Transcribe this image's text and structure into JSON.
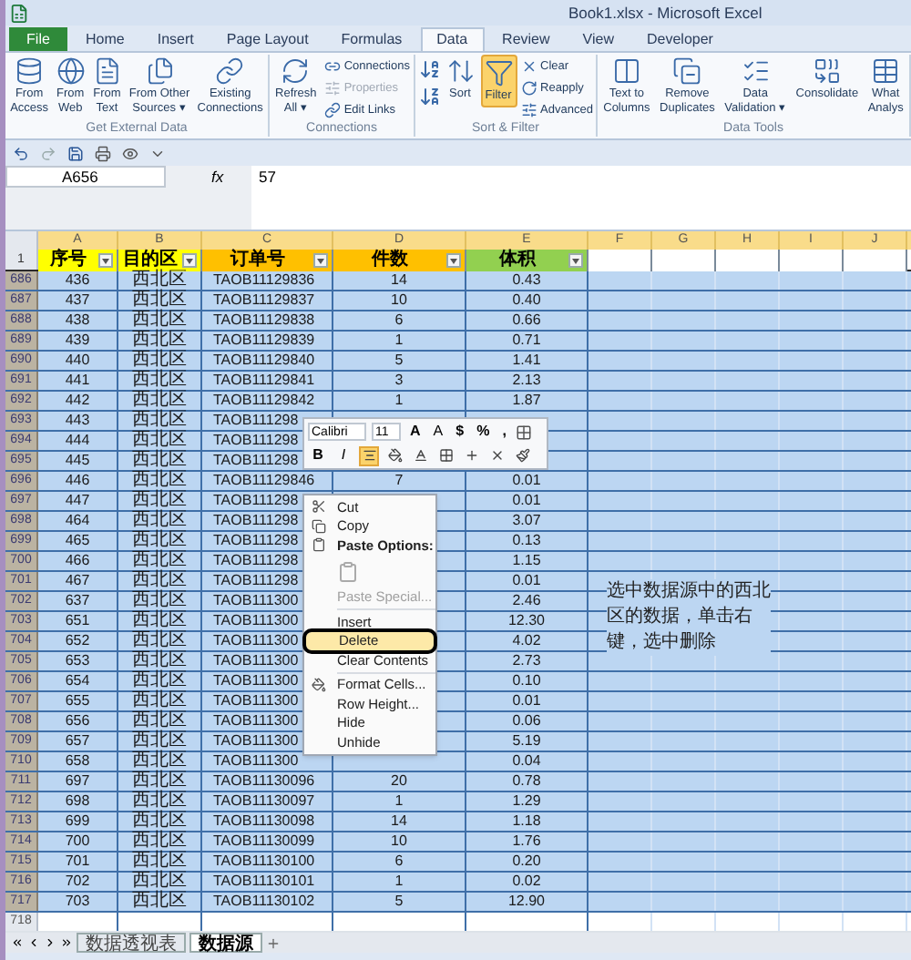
{
  "window": {
    "title": "Book1.xlsx - Microsoft Excel"
  },
  "file_button": "File",
  "tabs": [
    {
      "label": "Home",
      "selected": false
    },
    {
      "label": "Insert",
      "selected": false
    },
    {
      "label": "Page Layout",
      "selected": false
    },
    {
      "label": "Formulas",
      "selected": false
    },
    {
      "label": "Data",
      "selected": true
    },
    {
      "label": "Review",
      "selected": false
    },
    {
      "label": "View",
      "selected": false
    },
    {
      "label": "Developer",
      "selected": false
    }
  ],
  "ribbon": {
    "groups": [
      {
        "label": "Get External Data",
        "buttons": [
          {
            "kind": "large",
            "label": "From\nAccess"
          },
          {
            "kind": "large",
            "label": "From\nWeb"
          },
          {
            "kind": "large",
            "label": "From\nText"
          },
          {
            "kind": "large",
            "label": "From Other\nSources ▾"
          },
          {
            "kind": "large",
            "label": "Existing\nConnections"
          }
        ]
      },
      {
        "label": "Connections",
        "buttons": [
          {
            "kind": "large",
            "label": "Refresh\nAll ▾",
            "disabled": false
          },
          {
            "kind": "small",
            "label": "Connections",
            "disabled": false
          },
          {
            "kind": "small",
            "label": "Properties",
            "disabled": true
          },
          {
            "kind": "small",
            "label": "Edit Links",
            "disabled": false
          }
        ]
      },
      {
        "label": "Sort & Filter",
        "buttons": [
          {
            "kind": "icon"
          },
          {
            "kind": "large",
            "label": "Sort"
          },
          {
            "kind": "toggle",
            "label": "Filter",
            "on": true
          },
          {
            "kind": "small",
            "label": "Clear"
          },
          {
            "kind": "small",
            "label": "Reapply"
          },
          {
            "kind": "small",
            "label": "Advanced"
          }
        ]
      },
      {
        "label": "Data Tools",
        "buttons": [
          {
            "kind": "large",
            "label": "Text to\nColumns"
          },
          {
            "kind": "large",
            "label": "Remove\nDuplicates"
          },
          {
            "kind": "large",
            "label": "Data\nValidation ▾"
          },
          {
            "kind": "large",
            "label": "Consolidate"
          },
          {
            "kind": "large",
            "label": "What\nAnalys"
          }
        ]
      }
    ]
  },
  "formula_bar": {
    "name_box": "A656",
    "fx": "fx",
    "value": "57"
  },
  "table": {
    "columns": [
      {
        "letter": "A",
        "heading": "序号",
        "color": "#ffff00"
      },
      {
        "letter": "B",
        "heading": "目的区",
        "color": "#ffff00"
      },
      {
        "letter": "C",
        "heading": "订单号",
        "color": "#ffc000"
      },
      {
        "letter": "D",
        "heading": "件数",
        "color": "#ffc000"
      },
      {
        "letter": "E",
        "heading": "体积",
        "color": "#92d050"
      },
      {
        "letter": "F"
      },
      {
        "letter": "G"
      },
      {
        "letter": "H"
      },
      {
        "letter": "I"
      },
      {
        "letter": "J"
      }
    ],
    "header_row": "1",
    "rows": [
      {
        "num": "686",
        "selected": true,
        "a": "436",
        "b": "西北区",
        "c": "TAOB11129836",
        "d": "14",
        "e": "0.43"
      },
      {
        "num": "687",
        "selected": true,
        "a": "437",
        "b": "西北区",
        "c": "TAOB11129837",
        "d": "10",
        "e": "0.40"
      },
      {
        "num": "688",
        "selected": true,
        "a": "438",
        "b": "西北区",
        "c": "TAOB11129838",
        "d": "6",
        "e": "0.66"
      },
      {
        "num": "689",
        "selected": true,
        "a": "439",
        "b": "西北区",
        "c": "TAOB11129839",
        "d": "1",
        "e": "0.71"
      },
      {
        "num": "690",
        "selected": true,
        "a": "440",
        "b": "西北区",
        "c": "TAOB11129840",
        "d": "5",
        "e": "1.41"
      },
      {
        "num": "691",
        "selected": true,
        "a": "441",
        "b": "西北区",
        "c": "TAOB11129841",
        "d": "3",
        "e": "2.13"
      },
      {
        "num": "692",
        "selected": true,
        "a": "442",
        "b": "西北区",
        "c": "TAOB11129842",
        "d": "1",
        "e": "1.87"
      },
      {
        "num": "693",
        "selected": true,
        "a": "443",
        "b": "西北区",
        "c": "TAOB111298"
      },
      {
        "num": "694",
        "selected": true,
        "a": "444",
        "b": "西北区",
        "c": "TAOB111298"
      },
      {
        "num": "695",
        "selected": true,
        "a": "445",
        "b": "西北区",
        "c": "TAOB111298"
      },
      {
        "num": "696",
        "selected": true,
        "a": "446",
        "b": "西北区",
        "c": "TAOB11129846",
        "d": "7",
        "e": "0.01"
      },
      {
        "num": "697",
        "selected": true,
        "a": "447",
        "b": "西北区",
        "c": "TAOB111298",
        "e": "0.01"
      },
      {
        "num": "698",
        "selected": true,
        "a": "464",
        "b": "西北区",
        "c": "TAOB111298",
        "e": "3.07"
      },
      {
        "num": "699",
        "selected": true,
        "a": "465",
        "b": "西北区",
        "c": "TAOB111298",
        "e": "0.13"
      },
      {
        "num": "700",
        "selected": true,
        "a": "466",
        "b": "西北区",
        "c": "TAOB111298",
        "e": "1.15"
      },
      {
        "num": "701",
        "selected": true,
        "a": "467",
        "b": "西北区",
        "c": "TAOB111298",
        "e": "0.01"
      },
      {
        "num": "702",
        "selected": true,
        "a": "637",
        "b": "西北区",
        "c": "TAOB111300",
        "e": "2.46"
      },
      {
        "num": "703",
        "selected": true,
        "a": "651",
        "b": "西北区",
        "c": "TAOB111300",
        "e": "12.30"
      },
      {
        "num": "704",
        "selected": true,
        "a": "652",
        "b": "西北区",
        "c": "TAOB111300",
        "e": "4.02"
      },
      {
        "num": "705",
        "selected": true,
        "a": "653",
        "b": "西北区",
        "c": "TAOB111300",
        "e": "2.73"
      },
      {
        "num": "706",
        "selected": true,
        "a": "654",
        "b": "西北区",
        "c": "TAOB111300",
        "e": "0.10"
      },
      {
        "num": "707",
        "selected": true,
        "a": "655",
        "b": "西北区",
        "c": "TAOB111300",
        "e": "0.01"
      },
      {
        "num": "708",
        "selected": true,
        "a": "656",
        "b": "西北区",
        "c": "TAOB111300",
        "e": "0.06"
      },
      {
        "num": "709",
        "selected": true,
        "a": "657",
        "b": "西北区",
        "c": "TAOB111300",
        "e": "5.19"
      },
      {
        "num": "710",
        "selected": true,
        "a": "658",
        "b": "西北区",
        "c": "TAOB111300",
        "e": "0.04"
      },
      {
        "num": "711",
        "selected": true,
        "a": "697",
        "b": "西北区",
        "c": "TAOB11130096",
        "d": "20",
        "e": "0.78"
      },
      {
        "num": "712",
        "selected": true,
        "a": "698",
        "b": "西北区",
        "c": "TAOB11130097",
        "d": "1",
        "e": "1.29"
      },
      {
        "num": "713",
        "selected": true,
        "a": "699",
        "b": "西北区",
        "c": "TAOB11130098",
        "d": "14",
        "e": "1.18"
      },
      {
        "num": "714",
        "selected": true,
        "a": "700",
        "b": "西北区",
        "c": "TAOB11130099",
        "d": "10",
        "e": "1.76"
      },
      {
        "num": "715",
        "selected": true,
        "a": "701",
        "b": "西北区",
        "c": "TAOB11130100",
        "d": "6",
        "e": "0.20"
      },
      {
        "num": "716",
        "selected": true,
        "a": "702",
        "b": "西北区",
        "c": "TAOB11130101",
        "d": "1",
        "e": "0.02"
      },
      {
        "num": "717",
        "selected": true,
        "a": "703",
        "b": "西北区",
        "c": "TAOB11130102",
        "d": "5",
        "e": "12.90"
      },
      {
        "num": "718",
        "selected": false
      }
    ]
  },
  "note": {
    "lines": [
      "选中数据源中的西北",
      "区的数据，单击右",
      "键，选中删除"
    ]
  },
  "mini_toolbar": {
    "font": "Calibri",
    "size": "11",
    "row1": [
      "A",
      "A",
      "$",
      "%",
      ","
    ],
    "row2": [
      {
        "label": "B",
        "selected": false
      },
      {
        "label": "I",
        "selected": false
      },
      {
        "selected": true
      },
      {
        "selected": false
      },
      {
        "selected": false
      },
      {
        "selected": false
      },
      {
        "selected": false
      },
      {
        "selected": false
      },
      {
        "selected": false
      }
    ]
  },
  "context_menu": {
    "items": [
      {
        "kind": "item",
        "label": "Cut",
        "highlighted": false
      },
      {
        "kind": "item",
        "label": "Copy",
        "highlighted": false
      },
      {
        "kind": "heading",
        "label": "Paste Options:"
      },
      {
        "kind": "paste"
      },
      {
        "kind": "disabled",
        "label": "Paste Special..."
      },
      {
        "kind": "separator"
      },
      {
        "kind": "item",
        "label": "Insert",
        "highlighted": false
      },
      {
        "kind": "item",
        "label": "Delete",
        "highlighted": true
      },
      {
        "kind": "item",
        "label": "Clear Contents",
        "highlighted": false
      },
      {
        "kind": "separator"
      },
      {
        "kind": "item",
        "label": "Format Cells...",
        "highlighted": false
      },
      {
        "kind": "item",
        "label": "Row Height...",
        "highlighted": false
      },
      {
        "kind": "item",
        "label": "Hide",
        "highlighted": false
      },
      {
        "kind": "item",
        "label": "Unhide",
        "highlighted": false
      }
    ]
  },
  "sheet_tabs": [
    {
      "label": "数据透视表",
      "selected": false
    },
    {
      "label": "数据源",
      "selected": true
    }
  ]
}
